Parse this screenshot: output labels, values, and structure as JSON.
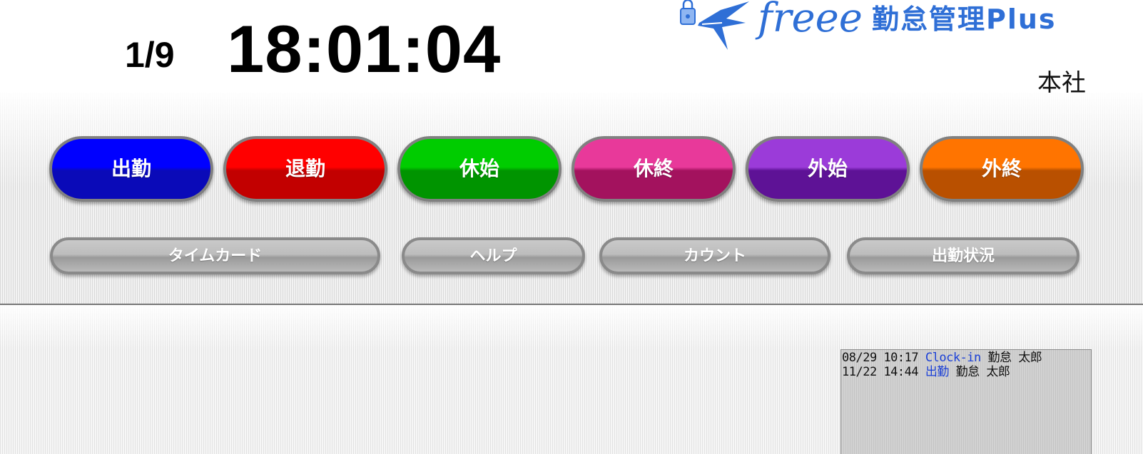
{
  "header": {
    "date": "1/9",
    "time": "18:01:04",
    "logo_brand": "freee",
    "logo_product": "勤怠管理Plus",
    "location": "本社"
  },
  "punch_buttons": [
    {
      "label": "出勤",
      "color_top": "#0000ff",
      "color_bottom": "#0a0ab8"
    },
    {
      "label": "退勤",
      "color_top": "#ff0000",
      "color_bottom": "#c20000"
    },
    {
      "label": "休始",
      "color_top": "#00cc00",
      "color_bottom": "#009400"
    },
    {
      "label": "休終",
      "color_top": "#e8399a",
      "color_bottom": "#a3125e"
    },
    {
      "label": "外始",
      "color_top": "#9b3bd9",
      "color_bottom": "#5e1296"
    },
    {
      "label": "外終",
      "color_top": "#ff7400",
      "color_bottom": "#b95000"
    }
  ],
  "menu_buttons": [
    {
      "label": "タイムカード"
    },
    {
      "label": "ヘルプ"
    },
    {
      "label": "カウント"
    },
    {
      "label": "出勤状況"
    }
  ],
  "log": [
    {
      "date": "08/29",
      "time": "10:17",
      "action": "Clock-in",
      "name": "勤怠 太郎"
    },
    {
      "date": "11/22",
      "time": "14:44",
      "action": "出勤",
      "name": "勤怠 太郎"
    }
  ],
  "colors": {
    "logo_blue": "#2f6fd6",
    "log_action": "#1a3fd6"
  }
}
